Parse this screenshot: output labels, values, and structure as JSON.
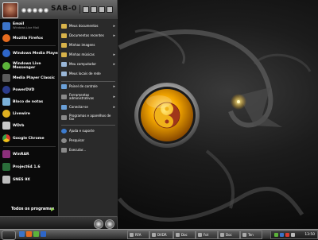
{
  "header": {
    "title": "SAB-0"
  },
  "pinned": [
    {
      "name": "Email",
      "sub": "Windows Live Mail",
      "color": "#3b74c9"
    },
    {
      "name": "Mozilla Firefox",
      "sub": "",
      "color": "#e56b1f"
    }
  ],
  "recent": [
    {
      "name": "Windows Media Player",
      "sub": "",
      "color": "#2e66c9"
    },
    {
      "name": "Windows Live",
      "name2": "Messenger",
      "color": "#5cb33a"
    },
    {
      "name": "Media Player Classic",
      "sub": "",
      "color": "#5a5a5a"
    },
    {
      "name": "PowerDVD",
      "sub": "",
      "color": "#2b3c8c"
    },
    {
      "name": "Bloco de notas",
      "sub": "",
      "color": "#7bb1d9"
    },
    {
      "name": "Livewire",
      "sub": "",
      "color": "#e0b020"
    },
    {
      "name": "WDrb",
      "sub": "",
      "color": "#c8c8c8"
    },
    {
      "name": "Google Chrome",
      "sub": "",
      "color": "#3b9f4a"
    },
    {
      "name": "WinRAR",
      "sub": "",
      "color": "#8b2f7a"
    },
    {
      "name": "Project64 1.6",
      "sub": "",
      "color": "#2a6d3a"
    },
    {
      "name": "SNES 9X",
      "sub": "",
      "color": "#bdbdbd"
    }
  ],
  "all_programs": "Todos os programas",
  "places": [
    {
      "label": "Meus documentos",
      "arrow": true,
      "color": "#d9b34a"
    },
    {
      "label": "Documentos recentes",
      "arrow": true,
      "color": "#d9b34a"
    },
    {
      "label": "Minhas imagens",
      "arrow": false,
      "color": "#d9b34a"
    },
    {
      "label": "Minhas músicas",
      "arrow": true,
      "color": "#d9b34a"
    },
    {
      "label": "Meu computador",
      "arrow": true,
      "color": "#9bb8d9"
    },
    {
      "label": "Meus locais de rede",
      "arrow": false,
      "color": "#9bb8d9"
    }
  ],
  "system": [
    {
      "label": "Painel de controle",
      "arrow": true,
      "color": "#6aa0d8"
    },
    {
      "label": "Ferramentas administrativas",
      "arrow": true,
      "color": "#8a8a8a"
    },
    {
      "label": "Conectar-se",
      "arrow": true,
      "color": "#6aa0d8"
    },
    {
      "label": "Programas e aparelhos de fax",
      "arrow": false,
      "color": "#8a8a8a"
    }
  ],
  "help": [
    {
      "label": "Ajuda e suporte",
      "color": "#3c7cd0"
    },
    {
      "label": "Pesquisar",
      "color": "#8a8a8a"
    },
    {
      "label": "Executar...",
      "color": "#8a8a8a"
    }
  ],
  "taskbar": {
    "tasks": [
      "RFA",
      "DVDR",
      "Doc",
      "Fot",
      "Doc",
      "Ten"
    ],
    "clock": "13:50"
  },
  "colors": {
    "accent": "#ffc107",
    "dragon_eye": "#ffd64a"
  }
}
